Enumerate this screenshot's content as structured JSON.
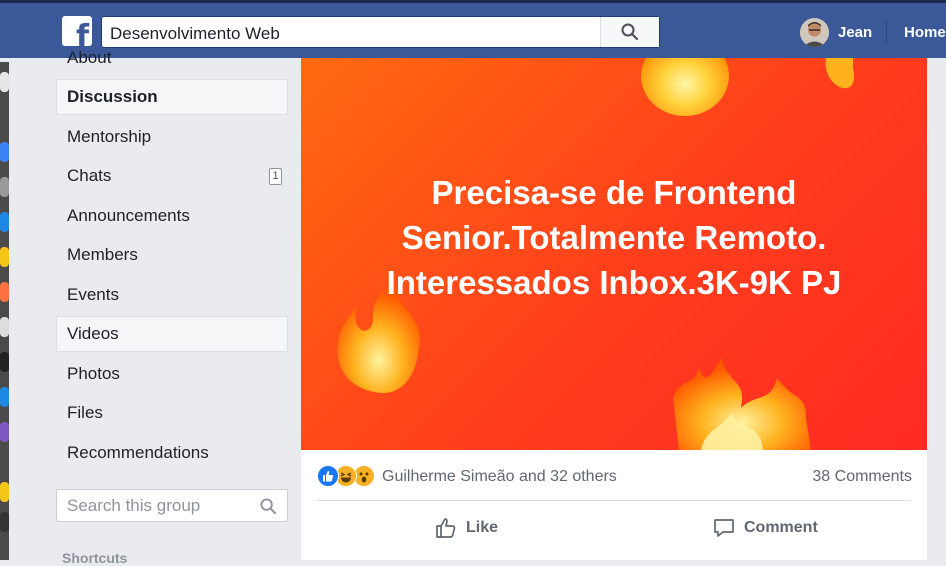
{
  "topbar": {
    "logo_icon": "facebook-f-logo-icon",
    "search_value": "Desenvolvimento Web",
    "search_icon": "search-icon",
    "user_name": "Jean",
    "home_label": "Home"
  },
  "sidebar": {
    "items": [
      {
        "label": "About"
      },
      {
        "label": "Discussion"
      },
      {
        "label": "Mentorship"
      },
      {
        "label": "Chats",
        "badge": "1"
      },
      {
        "label": "Announcements"
      },
      {
        "label": "Members"
      },
      {
        "label": "Events"
      },
      {
        "label": "Videos"
      },
      {
        "label": "Photos"
      },
      {
        "label": "Files"
      },
      {
        "label": "Recommendations"
      }
    ],
    "group_search_placeholder": "Search this group",
    "shortcuts_label": "Shortcuts"
  },
  "post": {
    "banner_lines": [
      "Precisa-se de Frontend",
      "Senior.Totalmente Remoto.",
      "Interessados Inbox.3K-9K PJ"
    ],
    "reaction_icons": [
      "like-reaction-icon",
      "haha-reaction-icon",
      "wow-reaction-icon"
    ],
    "reaction_names": "Guilherme Simeão and 32 others",
    "comments_count": "38 Comments",
    "like_label": "Like",
    "comment_label": "Comment"
  },
  "colors": {
    "brand": "#3b5998",
    "banner": "#ff4a18"
  }
}
